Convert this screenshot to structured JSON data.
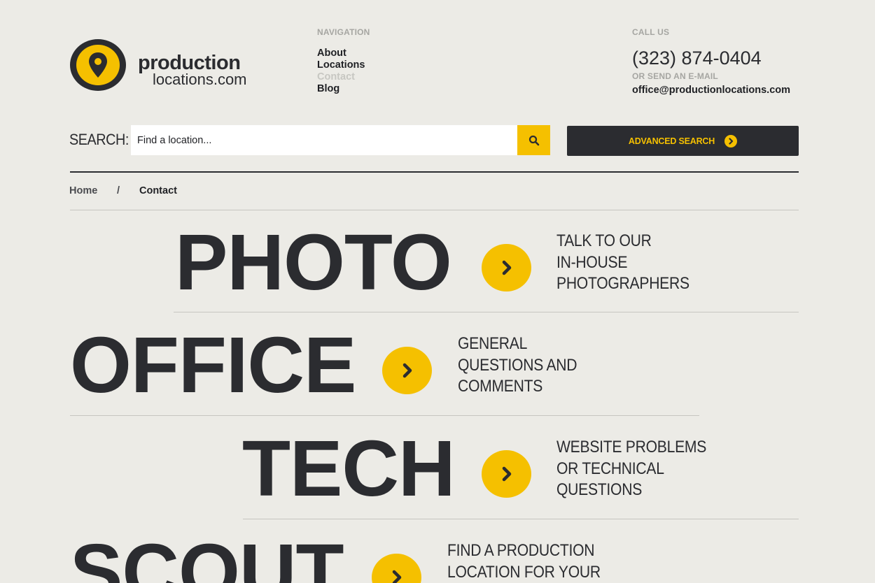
{
  "logo": {
    "line1": "production",
    "line2": "locations.com"
  },
  "nav": {
    "heading": "NAVIGATION",
    "items": [
      {
        "label": "About",
        "muted": false
      },
      {
        "label": "Locations",
        "muted": false
      },
      {
        "label": "Contact",
        "muted": true
      },
      {
        "label": "Blog",
        "muted": false
      }
    ]
  },
  "contact": {
    "heading": "CALL US",
    "phone": "(323) 874-0404",
    "alt_heading": "OR SEND AN E-MAIL",
    "email": "office@productionlocations.com"
  },
  "search": {
    "label": "SEARCH:",
    "placeholder": "Find a location...",
    "advanced_label": "ADVANCED SEARCH"
  },
  "breadcrumb": {
    "home": "Home",
    "separator": "/",
    "current": "Contact"
  },
  "departments": [
    {
      "title": "PHOTO",
      "lines": [
        "TALK TO OUR",
        "IN-HOUSE",
        "PHOTOGRAPHERS"
      ]
    },
    {
      "title": "OFFICE",
      "lines": [
        "GENERAL",
        "QUESTIONS AND",
        "COMMENTS"
      ]
    },
    {
      "title": "TECH",
      "lines": [
        "WEBSITE PROBLEMS",
        "OR TECHNICAL",
        "QUESTIONS"
      ]
    },
    {
      "title": "SCOUT",
      "lines": [
        "FIND A PRODUCTION",
        "LOCATION FOR YOUR"
      ]
    }
  ],
  "colors": {
    "accent": "#f5c000",
    "dark": "#2b2c30",
    "background": "#ecebe6"
  }
}
